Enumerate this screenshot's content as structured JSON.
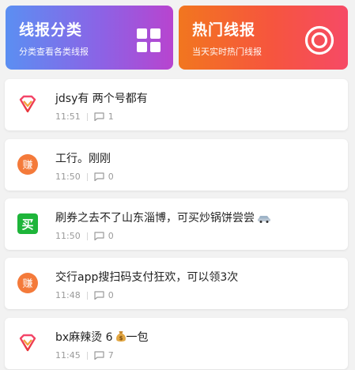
{
  "banners": {
    "left": {
      "title": "线报分类",
      "subtitle": "分类查看各类线报",
      "icon": "grid-icon"
    },
    "right": {
      "title": "热门线报",
      "subtitle": "当天实时热门线报",
      "icon": "target-icon"
    }
  },
  "feed": [
    {
      "avatar": "diamond-icon",
      "title": "jdsy有 两个号都有",
      "time": "11:51",
      "comments": "1"
    },
    {
      "avatar": "zhuan-icon",
      "title": "工行。刚刚",
      "time": "11:50",
      "comments": "0"
    },
    {
      "avatar": "mai-icon",
      "title": "刷券之去不了山东淄博，可买炒锅饼尝尝",
      "emoji": "car-icon",
      "time": "11:50",
      "comments": "0"
    },
    {
      "avatar": "zhuan-icon",
      "title": "交行app搜扫码支付狂欢，可以领3次",
      "time": "11:48",
      "comments": "0"
    },
    {
      "avatar": "diamond-icon",
      "title": "bx麻辣烫 6",
      "emoji": "money-bag-icon",
      "title_suffix": "一包",
      "time": "11:45",
      "comments": "7"
    }
  ],
  "avatar_glyphs": {
    "zhuan": "赚",
    "mai": "买"
  },
  "colors": {
    "left_banner": "#8a64e6",
    "right_banner": "#f6553e",
    "zhuan_avatar": "#f47a3a",
    "mai_avatar": "#1eb53a",
    "diamond": "#e8363b"
  }
}
